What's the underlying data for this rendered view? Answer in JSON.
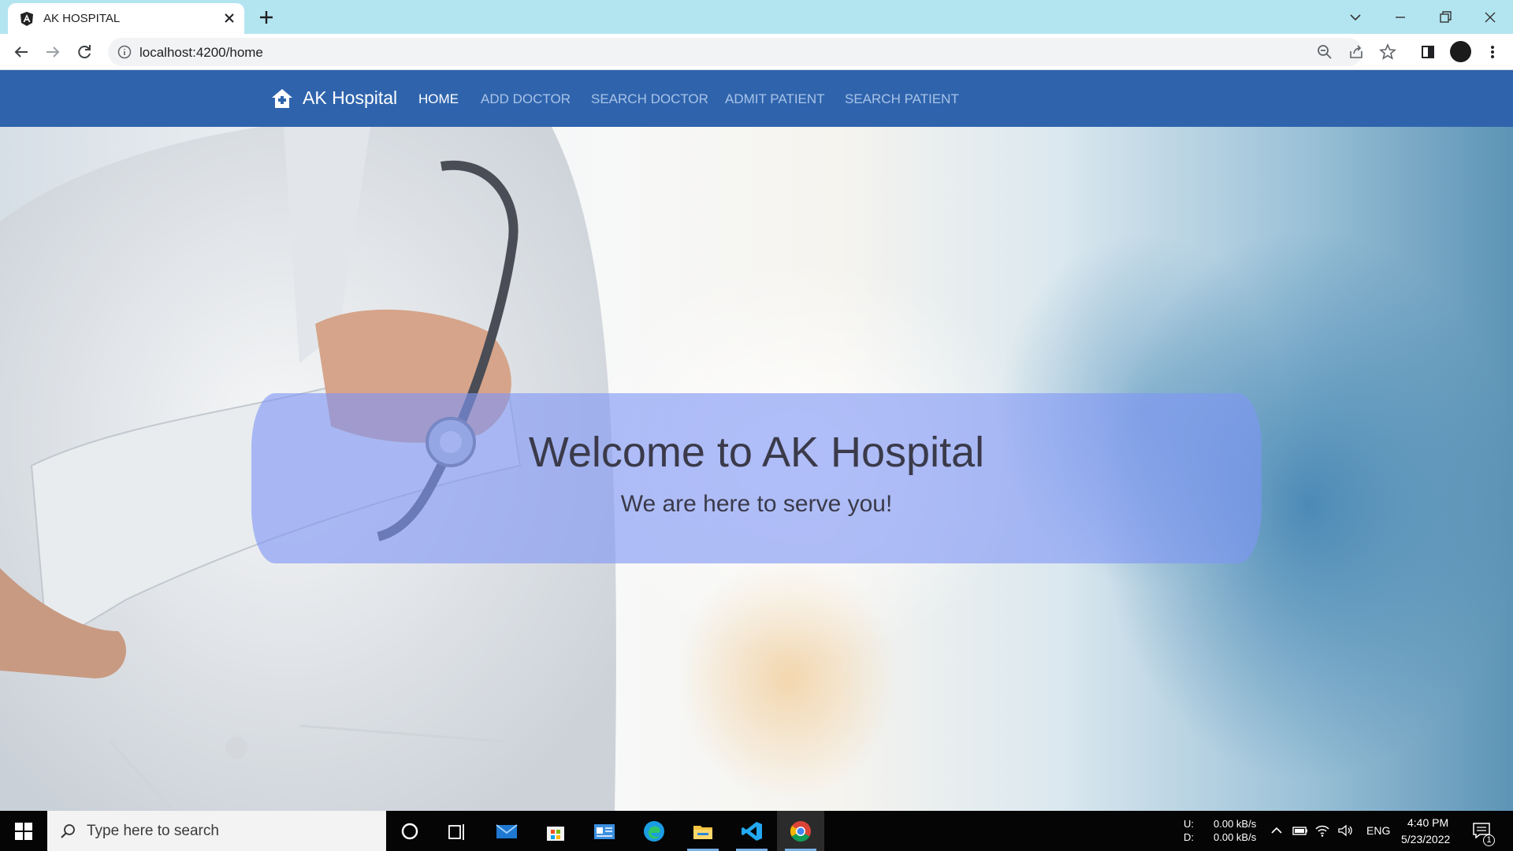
{
  "browser": {
    "tab_title": "AK HOSPITAL",
    "url": "localhost:4200/home"
  },
  "app": {
    "brand": "AK Hospital",
    "nav": [
      {
        "label": "HOME",
        "active": true
      },
      {
        "label": "ADD DOCTOR",
        "active": false
      },
      {
        "label": "SEARCH DOCTOR",
        "active": false
      },
      {
        "label": "ADMIT PATIENT",
        "active": false
      },
      {
        "label": "SEARCH PATIENT",
        "active": false
      }
    ],
    "hero": {
      "title": "Welcome to AK Hospital",
      "subtitle": "We are here to serve you!"
    },
    "colors": {
      "navbar": "#2f64ad",
      "banner": "#8096f5"
    }
  },
  "taskbar": {
    "search_placeholder": "Type here to search",
    "apps": [
      "cortana-icon",
      "task-view-icon",
      "mail-icon",
      "store-icon",
      "news-icon",
      "edge-icon",
      "file-explorer-icon",
      "vscode-icon",
      "chrome-icon"
    ],
    "net_up_label": "U:",
    "net_down_label": "D:",
    "net_up": "0.00 kB/s",
    "net_down": "0.00 kB/s",
    "language": "ENG",
    "time": "4:40 PM",
    "date": "5/23/2022",
    "notification_count": "1"
  }
}
